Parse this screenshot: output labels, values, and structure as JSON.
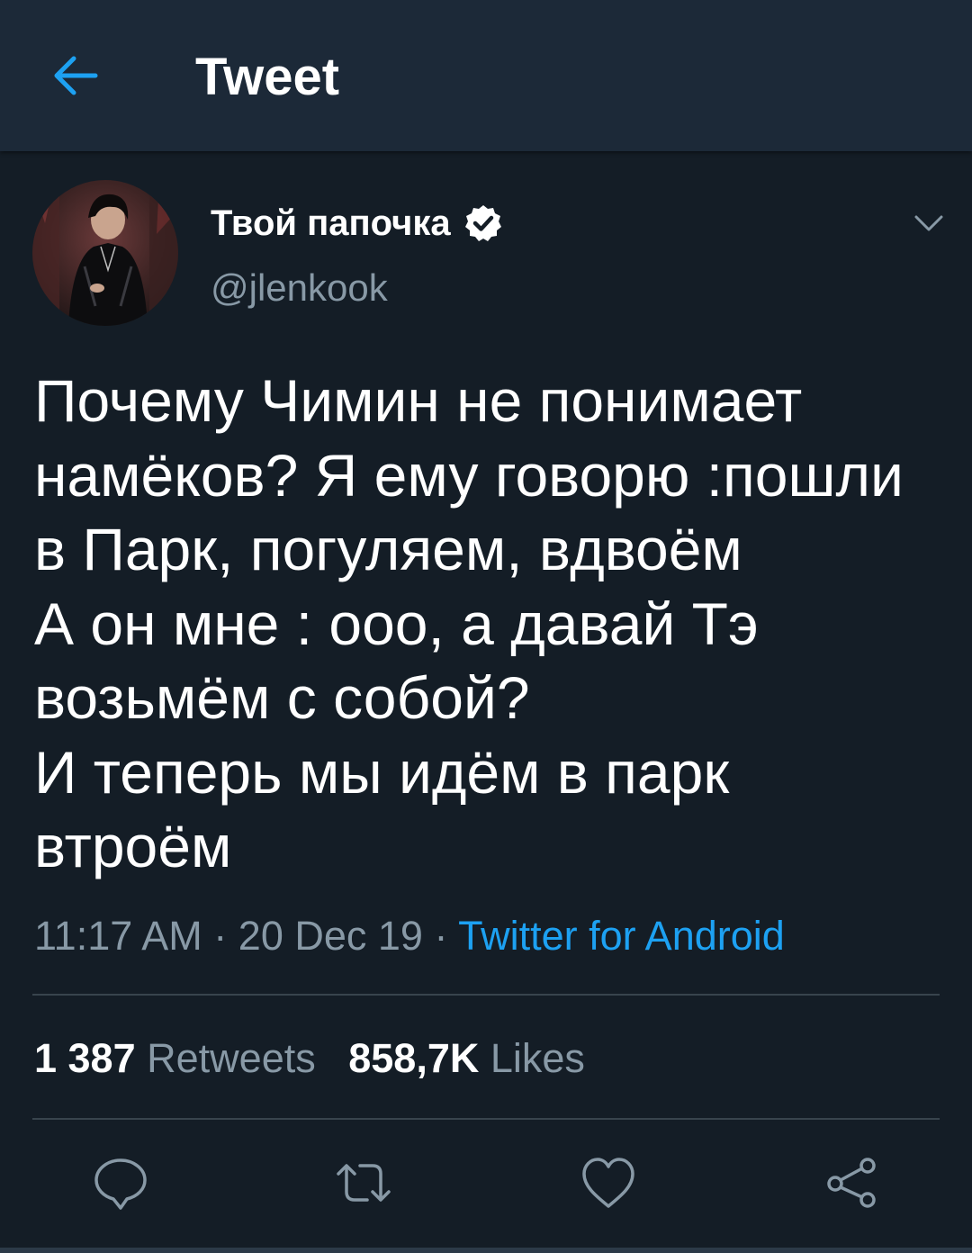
{
  "header": {
    "title": "Tweet",
    "back_icon": "arrow-left-icon"
  },
  "author": {
    "display_name": "Твой папочка",
    "handle": "@jlenkook",
    "verified": true
  },
  "tweet": {
    "lines": [
      "Почему Чимин не понимает",
      "намёков? Я ему говорю :пошли",
      "в Парк, погуляем, вдвоём",
      "А он мне : ооо, а давай Тэ",
      "возьмём с собой?",
      "И теперь мы идём в парк",
      "втроём"
    ],
    "time": "11:17 AM",
    "date": "20 Dec 19",
    "separator": " · ",
    "source": "Twitter for Android"
  },
  "stats": {
    "retweets_count": "1 387",
    "retweets_label": "Retweets",
    "likes_count": "858,7K",
    "likes_label": "Likes"
  },
  "actions": [
    "reply-icon",
    "retweet-icon",
    "like-icon",
    "share-icon"
  ],
  "colors": {
    "background": "#141d26",
    "header": "#1c2938",
    "accent": "#1da1f2",
    "secondary_text": "#8899a6",
    "divider": "#38444d"
  }
}
